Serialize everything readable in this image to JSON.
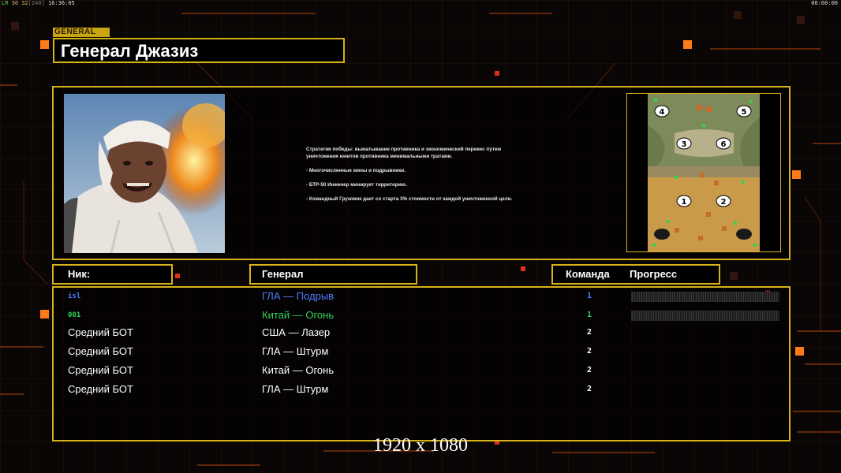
{
  "status_bar": {
    "left_prefix": "LR",
    "left_values": "30 32",
    "left_bracket": "[240]",
    "time": "16:36:05",
    "right_time": "00:00:00"
  },
  "general": {
    "tag": "GENERAL",
    "name": "Генерал Джазиз",
    "description": [
      "Стратегия победы: выматывание противника и экономический перевес путем",
      " уничтожения юнитов противника минимальными тратами.",
      "",
      "- Многочисленные мины и подрывники.",
      "",
      "- БТР-50 Инженер минирует территорию.",
      "",
      "- Командный Грузовик дает со старта 3% стоимости от каждой уничтоженной цели."
    ],
    "map_slots": [
      "4",
      "5",
      "3",
      "6",
      "1",
      "2"
    ]
  },
  "table": {
    "headers": {
      "nick": "Ник:",
      "general": "Генерал",
      "team": "Команда",
      "progress": "Прогресс"
    },
    "rows": [
      {
        "nick": "isl",
        "general": "ГЛА — Подрыв",
        "team": "1",
        "color": "#4f7cff",
        "small": true,
        "progress": 0
      },
      {
        "nick": "001",
        "general": "Китай — Огонь",
        "team": "1",
        "color": "#2fd35a",
        "small": true,
        "progress": 0
      },
      {
        "nick": "Средний БОТ",
        "general": "США — Лазер",
        "team": "2",
        "color": "#ffffff",
        "small": false
      },
      {
        "nick": "Средний БОТ",
        "general": "ГЛА — Штурм",
        "team": "2",
        "color": "#ffffff",
        "small": false
      },
      {
        "nick": "Средний БОТ",
        "general": "Китай — Огонь",
        "team": "2",
        "color": "#ffffff",
        "small": false
      },
      {
        "nick": "Средний БОТ",
        "general": "ГЛА — Штурм",
        "team": "2",
        "color": "#ffffff",
        "small": false
      }
    ]
  },
  "resolution_label": "1920 x 1080",
  "colors": {
    "accent": "#d6b21a",
    "background": "#0a0605",
    "decor_orange": "#ff6a1a"
  }
}
